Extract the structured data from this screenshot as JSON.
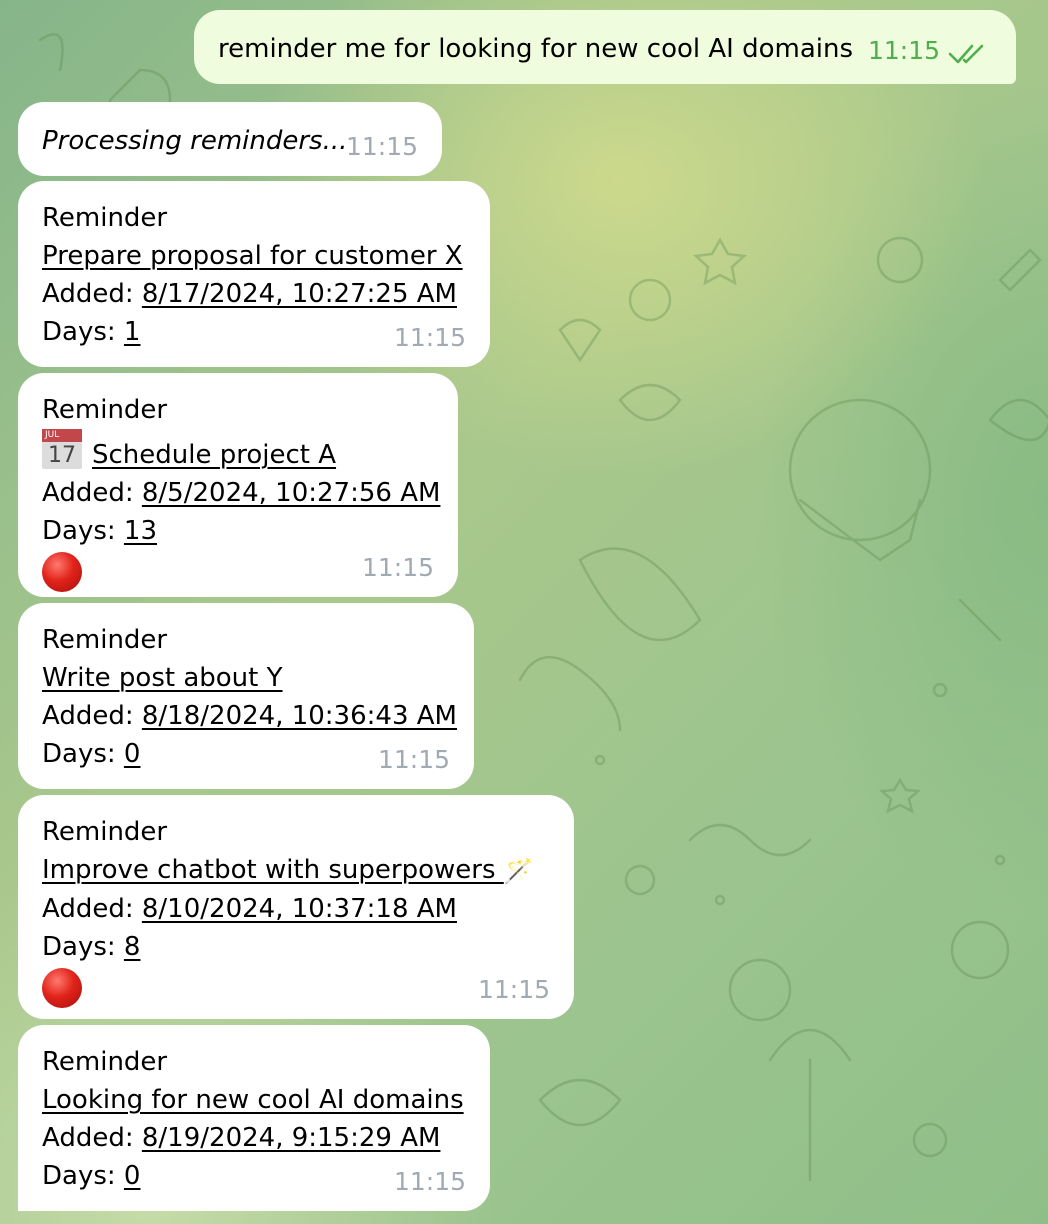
{
  "outgoing": {
    "text": "reminder me for looking for new cool AI domains",
    "time": "11:15",
    "status_icon": "double-check-read-icon"
  },
  "processing": {
    "text": "Processing reminders...",
    "time": "11:15"
  },
  "reminders": [
    {
      "heading": "Reminder",
      "title": "Prepare proposal for customer X",
      "added_label": "Added:",
      "added": "8/17/2024, 10:27:25 AM",
      "days_label": "Days:",
      "days": "1",
      "time": "11:15"
    },
    {
      "heading": "Reminder",
      "prefix_icon": "calendar-icon",
      "calendar_month": "JUL",
      "calendar_day": "17",
      "title": "Schedule project A",
      "added_label": "Added:",
      "added": "8/5/2024, 10:27:56 AM",
      "days_label": "Days:",
      "days": "13",
      "status_icon": "red-circle-icon",
      "time": "11:15"
    },
    {
      "heading": "Reminder",
      "title": "Write post about Y",
      "added_label": "Added:",
      "added": "8/18/2024, 10:36:43 AM",
      "days_label": "Days:",
      "days": "0",
      "time": "11:15"
    },
    {
      "heading": "Reminder",
      "title": "Improve chatbot with superpowers ",
      "suffix_emoji": "🪄",
      "added_label": "Added:",
      "added": "8/10/2024, 10:37:18 AM",
      "days_label": "Days:",
      "days": "8",
      "status_icon": "red-circle-icon",
      "time": "11:15"
    },
    {
      "heading": "Reminder",
      "title": "Looking for new cool AI domains",
      "added_label": "Added:",
      "added": "8/19/2024, 9:15:29 AM",
      "days_label": "Days:",
      "days": "0",
      "time": "11:15"
    }
  ],
  "colors": {
    "outgoing_bubble": "#effdde",
    "outgoing_time": "#4fae4e",
    "incoming_bubble": "#ffffff",
    "incoming_time": "#a1aab3",
    "status_red": "#e0231a"
  }
}
